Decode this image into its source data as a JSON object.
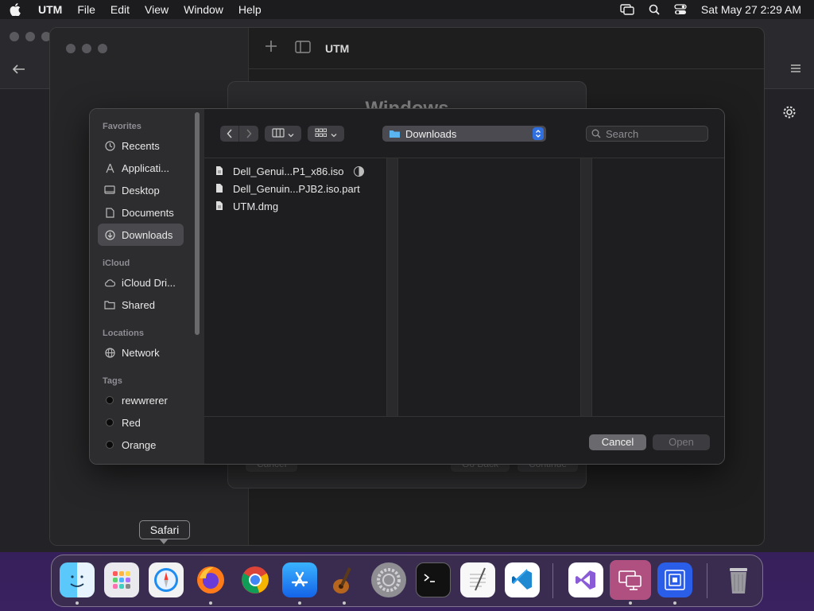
{
  "menubar": {
    "app_name": "UTM",
    "items": [
      "File",
      "Edit",
      "View",
      "Window",
      "Help"
    ],
    "datetime": "Sat May 27  2:29 AM"
  },
  "utm_window": {
    "title": "UTM"
  },
  "wizard": {
    "title": "Windows",
    "cancel_label": "Cancel",
    "goback_label": "Go Back",
    "continue_label": "Continue"
  },
  "dialog": {
    "sidebar": {
      "favorites_header": "Favorites",
      "favorites": [
        {
          "label": "Recents",
          "icon": "clock-icon"
        },
        {
          "label": "Applicati...",
          "icon": "applications-icon"
        },
        {
          "label": "Desktop",
          "icon": "desktop-icon"
        },
        {
          "label": "Documents",
          "icon": "document-icon"
        },
        {
          "label": "Downloads",
          "icon": "download-icon",
          "selected": true
        }
      ],
      "icloud_header": "iCloud",
      "icloud": [
        {
          "label": "iCloud Dri...",
          "icon": "cloud-icon"
        },
        {
          "label": "Shared",
          "icon": "shared-folder-icon"
        }
      ],
      "locations_header": "Locations",
      "locations": [
        {
          "label": "Network",
          "icon": "globe-icon"
        }
      ],
      "tags_header": "Tags",
      "tags": [
        {
          "label": "rewwrerer"
        },
        {
          "label": "Red"
        },
        {
          "label": "Orange"
        }
      ]
    },
    "location": "Downloads",
    "search_placeholder": "Search",
    "files": [
      {
        "name": "Dell_Genui...P1_x86.iso",
        "in_progress": true
      },
      {
        "name": "Dell_Genuin...PJB2.iso.part",
        "in_progress": false
      },
      {
        "name": "UTM.dmg",
        "in_progress": false
      }
    ],
    "cancel_label": "Cancel",
    "open_label": "Open"
  },
  "tooltip": {
    "text": "Safari"
  },
  "dock": {
    "apps": [
      {
        "name": "finder-icon",
        "running": true
      },
      {
        "name": "launchpad-icon",
        "running": false
      },
      {
        "name": "safari-icon",
        "running": false
      },
      {
        "name": "firefox-icon",
        "running": true
      },
      {
        "name": "chrome-icon",
        "running": false
      },
      {
        "name": "app-store-icon",
        "running": true
      },
      {
        "name": "garageband-icon",
        "running": true
      },
      {
        "name": "system-settings-icon",
        "running": false
      },
      {
        "name": "terminal-icon",
        "running": false
      },
      {
        "name": "textedit-icon",
        "running": false
      },
      {
        "name": "vscode-icon",
        "running": false
      },
      {
        "name": "visual-studio-icon",
        "running": false
      },
      {
        "name": "utm-icon",
        "running": true
      },
      {
        "name": "screen-icon",
        "running": true
      },
      {
        "name": "trash-icon",
        "running": false
      }
    ]
  }
}
